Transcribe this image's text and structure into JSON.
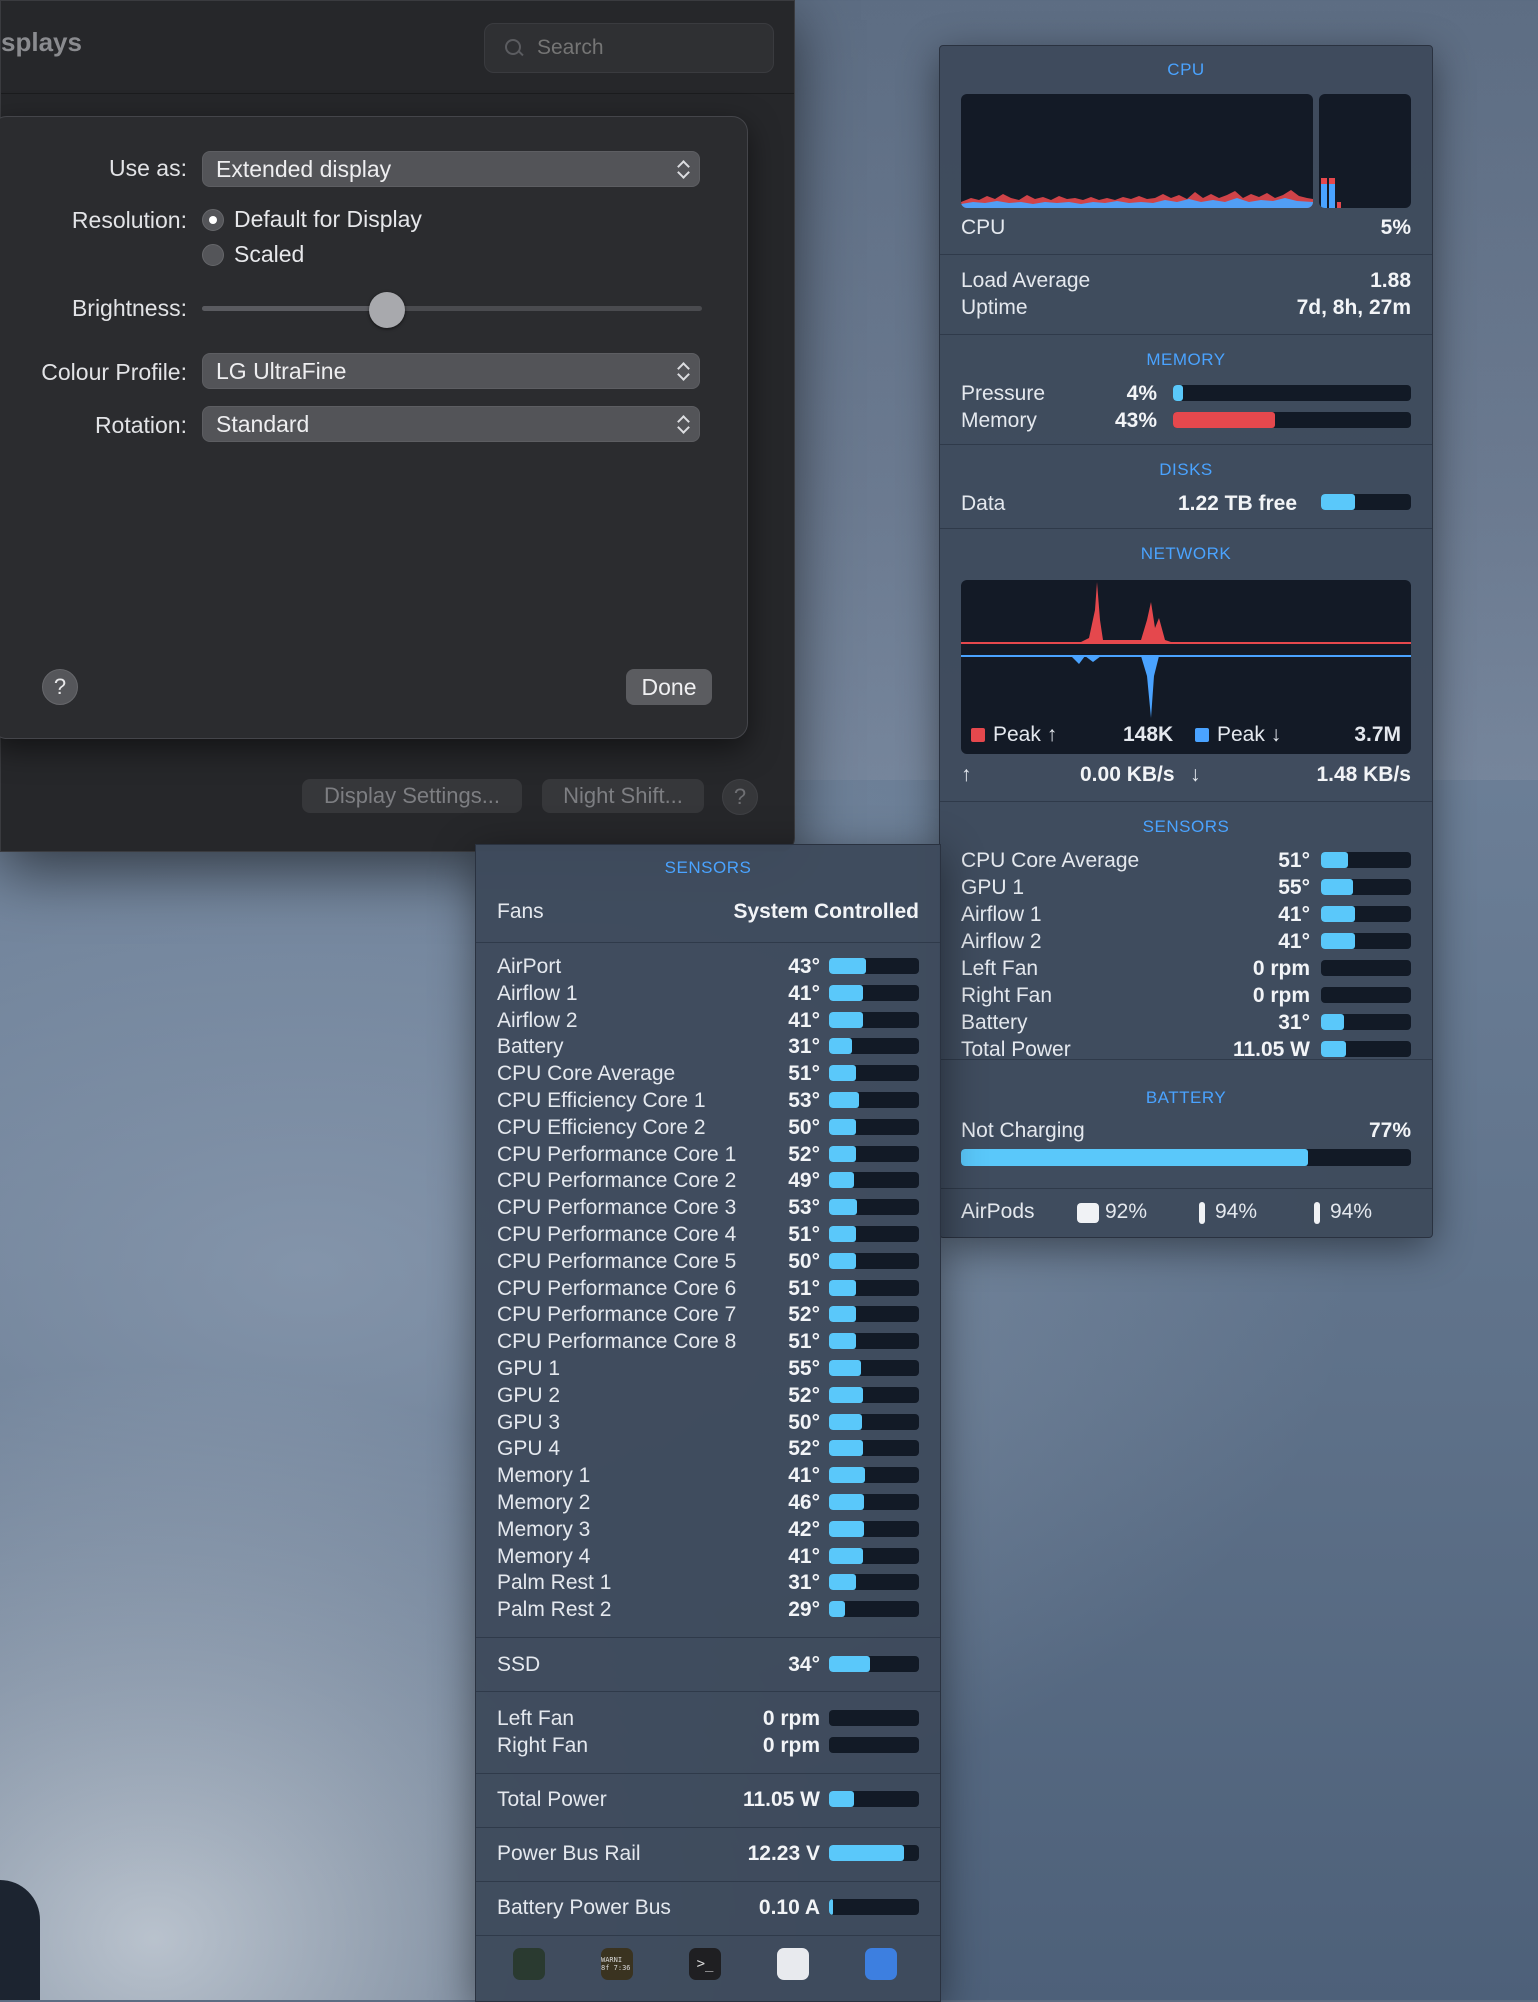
{
  "window": {
    "title": "splays",
    "search_placeholder": "Search"
  },
  "sheet": {
    "use_as_label": "Use as:",
    "use_as_value": "Extended display",
    "resolution_label": "Resolution:",
    "resolution_options": [
      "Default for Display",
      "Scaled"
    ],
    "resolution_selected": "Default for Display",
    "brightness_label": "Brightness:",
    "brightness_level": 0.37,
    "colour_profile_label": "Colour Profile:",
    "colour_profile_value": "LG UltraFine",
    "rotation_label": "Rotation:",
    "rotation_value": "Standard",
    "help": "?",
    "done": "Done"
  },
  "bottom_bar": {
    "display_settings": "Display Settings...",
    "night_shift": "Night Shift...",
    "help": "?"
  },
  "stats": {
    "cpu": {
      "title": "CPU",
      "label": "CPU",
      "value": "5%",
      "load_label": "Load Average",
      "load_value": "1.88",
      "uptime_label": "Uptime",
      "uptime_value": "7d, 8h, 27m"
    },
    "memory": {
      "title": "MEMORY",
      "rows": [
        {
          "label": "Pressure",
          "value": "4%",
          "level": 0.04,
          "color": "#5ac8fa"
        },
        {
          "label": "Memory",
          "value": "43%",
          "level": 0.43,
          "color": "#e5484d"
        }
      ]
    },
    "disks": {
      "title": "DISKS",
      "label": "Data",
      "value": "1.22 TB free",
      "level": 0.38
    },
    "network": {
      "title": "NETWORK",
      "peak_up_label": "Peak ↑",
      "peak_up_value": "148K",
      "peak_down_label": "Peak ↓",
      "peak_down_value": "3.7M",
      "up_arrow": "↑",
      "up_rate": "0.00 KB/s",
      "down_arrow": "↓",
      "down_rate": "1.48 KB/s",
      "up_color": "#e5484d",
      "down_color": "#4aa3ff"
    },
    "sensors": {
      "title": "SENSORS",
      "rows": [
        {
          "label": "CPU Core Average",
          "value": "51°",
          "level": 0.3
        },
        {
          "label": "GPU 1",
          "value": "55°",
          "level": 0.35
        },
        {
          "label": "Airflow 1",
          "value": "41°",
          "level": 0.38
        },
        {
          "label": "Airflow 2",
          "value": "41°",
          "level": 0.38
        },
        {
          "label": "Left Fan",
          "value": "0 rpm",
          "level": 0
        },
        {
          "label": "Right Fan",
          "value": "0 rpm",
          "level": 0
        },
        {
          "label": "Battery",
          "value": "31°",
          "level": 0.25
        },
        {
          "label": "Total Power",
          "value": "11.05 W",
          "level": 0.28
        }
      ]
    },
    "battery": {
      "title": "BATTERY",
      "status": "Not Charging",
      "value": "77%",
      "level": 0.77
    },
    "airpods": {
      "label": "AirPods",
      "case": "92%",
      "left": "94%",
      "right": "94%"
    }
  },
  "sensors_detail": {
    "title": "SENSORS",
    "fans_label": "Fans",
    "fans_value": "System Controlled",
    "temps": [
      {
        "label": "AirPort",
        "value": "43°",
        "level": 0.41
      },
      {
        "label": "Airflow 1",
        "value": "41°",
        "level": 0.38
      },
      {
        "label": "Airflow 2",
        "value": "41°",
        "level": 0.38
      },
      {
        "label": "Battery",
        "value": "31°",
        "level": 0.25
      },
      {
        "label": "CPU Core Average",
        "value": "51°",
        "level": 0.3
      },
      {
        "label": "CPU Efficiency Core 1",
        "value": "53°",
        "level": 0.33
      },
      {
        "label": "CPU Efficiency Core 2",
        "value": "50°",
        "level": 0.3
      },
      {
        "label": "CPU Performance Core 1",
        "value": "52°",
        "level": 0.3
      },
      {
        "label": "CPU Performance Core 2",
        "value": "49°",
        "level": 0.28
      },
      {
        "label": "CPU Performance Core 3",
        "value": "53°",
        "level": 0.31
      },
      {
        "label": "CPU Performance Core 4",
        "value": "51°",
        "level": 0.3
      },
      {
        "label": "CPU Performance Core 5",
        "value": "50°",
        "level": 0.3
      },
      {
        "label": "CPU Performance Core 6",
        "value": "51°",
        "level": 0.3
      },
      {
        "label": "CPU Performance Core 7",
        "value": "52°",
        "level": 0.3
      },
      {
        "label": "CPU Performance Core 8",
        "value": "51°",
        "level": 0.3
      },
      {
        "label": "GPU 1",
        "value": "55°",
        "level": 0.35
      },
      {
        "label": "GPU 2",
        "value": "52°",
        "level": 0.38
      },
      {
        "label": "GPU 3",
        "value": "50°",
        "level": 0.37
      },
      {
        "label": "GPU 4",
        "value": "52°",
        "level": 0.38
      },
      {
        "label": "Memory 1",
        "value": "41°",
        "level": 0.4
      },
      {
        "label": "Memory 2",
        "value": "46°",
        "level": 0.39
      },
      {
        "label": "Memory 3",
        "value": "42°",
        "level": 0.39
      },
      {
        "label": "Memory 4",
        "value": "41°",
        "level": 0.38
      },
      {
        "label": "Palm Rest 1",
        "value": "31°",
        "level": 0.3
      },
      {
        "label": "Palm Rest 2",
        "value": "29°",
        "level": 0.18
      }
    ],
    "ssd": {
      "label": "SSD",
      "value": "34°",
      "level": 0.45
    },
    "fans": [
      {
        "label": "Left Fan",
        "value": "0 rpm",
        "level": 0
      },
      {
        "label": "Right Fan",
        "value": "0 rpm",
        "level": 0
      }
    ],
    "total_power": {
      "label": "Total Power",
      "value": "11.05 W",
      "level": 0.28
    },
    "power_bus_rail": {
      "label": "Power Bus Rail",
      "value": "12.23 V",
      "level": 0.83
    },
    "battery_power_bus": {
      "label": "Battery Power Bus",
      "value": "0.10 A",
      "level": 0.02
    }
  },
  "dock": [
    {
      "name": "activity-monitor-icon",
      "color": "#2a3a30"
    },
    {
      "name": "console-icon",
      "color": "#3a3320",
      "text": "WARNI 8f 7:36"
    },
    {
      "name": "terminal-icon",
      "color": "#1f1f22",
      "text": ">_"
    },
    {
      "name": "printer-icon",
      "color": "#e8eaee"
    },
    {
      "name": "safari-icon",
      "color": "#3d7fe0"
    }
  ]
}
